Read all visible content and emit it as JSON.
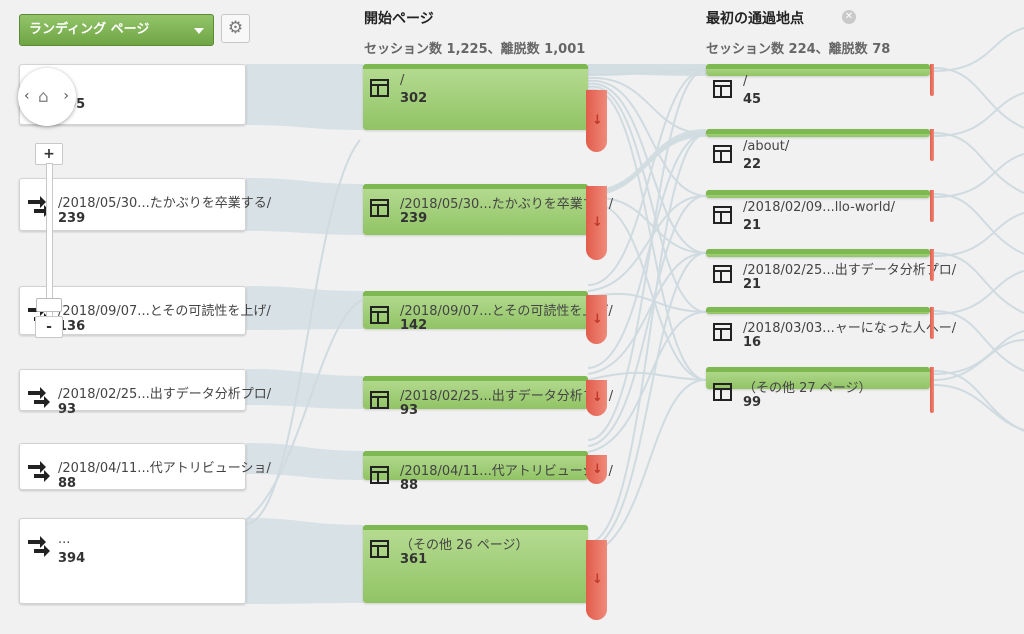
{
  "toolbar": {
    "dropdown_label": "ランディング ページ",
    "settings_icon": "gear-icon"
  },
  "columns": [
    {
      "title": "開始ページ",
      "subtitle": "セッション数 1,225、離脱数 1,001"
    },
    {
      "title": "最初の通過地点",
      "subtitle": "セッション数 224、離脱数 78"
    }
  ],
  "sources": [
    {
      "label": "/",
      "value": "305"
    },
    {
      "label": "/2018/05/30...たかぶりを卒業する/",
      "value": "239"
    },
    {
      "label": "/2018/09/07...とその可読性を上げ/",
      "value": "136"
    },
    {
      "label": "/2018/02/25...出すデータ分析プロ/",
      "value": "93"
    },
    {
      "label": "/2018/04/11...代アトリビューショ/",
      "value": "88"
    },
    {
      "label": "...",
      "value": "394"
    }
  ],
  "start_pages": [
    {
      "label": "/",
      "value": "302"
    },
    {
      "label": "/2018/05/30...たかぶりを卒業する/",
      "value": "239"
    },
    {
      "label": "/2018/09/07...とその可読性を上げ/",
      "value": "142"
    },
    {
      "label": "/2018/02/25...出すデータ分析プロ/",
      "value": "93"
    },
    {
      "label": "/2018/04/11...代アトリビューショ/",
      "value": "88"
    },
    {
      "label": "（その他 26 ページ）",
      "value": "361"
    }
  ],
  "first_interactions": [
    {
      "label": "/",
      "value": "45"
    },
    {
      "label": "/about/",
      "value": "22"
    },
    {
      "label": "/2018/02/09...llo-world/",
      "value": "21"
    },
    {
      "label": "/2018/02/25...出すデータ分析プロ/",
      "value": "21"
    },
    {
      "label": "/2018/03/03...ャーになった人へー/",
      "value": "16"
    },
    {
      "label": "（その他 27 ページ）",
      "value": "99"
    }
  ],
  "zoom": {
    "plus_label": "+",
    "minus_label": "-"
  },
  "colors": {
    "node_green": "#91c465",
    "drop_red": "#e25c4a",
    "flow_gray": "#d3dde1"
  }
}
